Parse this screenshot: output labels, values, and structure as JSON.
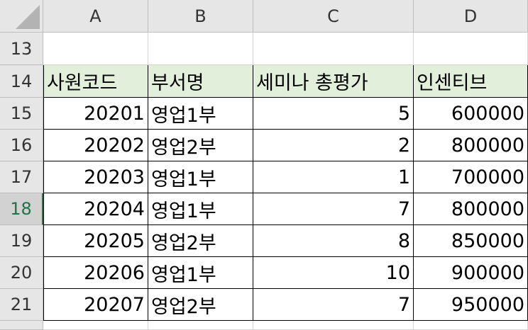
{
  "columns": [
    "A",
    "B",
    "C",
    "D"
  ],
  "rows": [
    "13",
    "14",
    "15",
    "16",
    "17",
    "18",
    "19",
    "20",
    "21"
  ],
  "active_row": "18",
  "table": {
    "headers": [
      "사원코드",
      "부서명",
      "세미나 총평가",
      "인센티브"
    ],
    "records": [
      [
        "20201",
        "영업1부",
        "5",
        "600000"
      ],
      [
        "20202",
        "영업2부",
        "2",
        "800000"
      ],
      [
        "20203",
        "영업1부",
        "1",
        "700000"
      ],
      [
        "20204",
        "영업1부",
        "7",
        "800000"
      ],
      [
        "20205",
        "영업2부",
        "8",
        "850000"
      ],
      [
        "20206",
        "영업1부",
        "10",
        "900000"
      ],
      [
        "20207",
        "영업2부",
        "7",
        "950000"
      ]
    ]
  },
  "colors": {
    "header_fill": "#e2efda",
    "active_accent": "#217346"
  }
}
